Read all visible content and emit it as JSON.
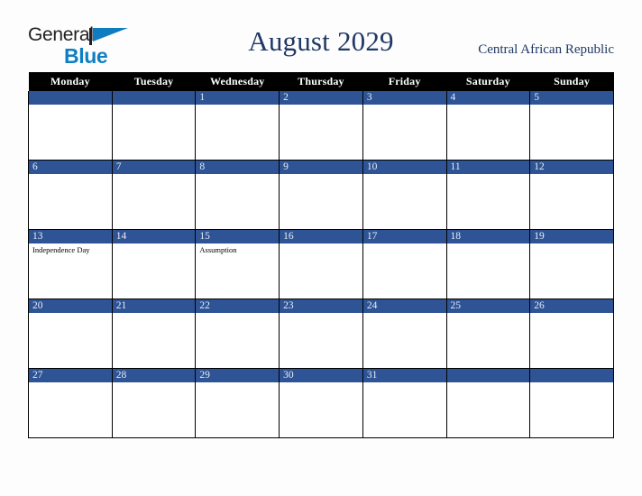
{
  "brand": {
    "name_part1": "General",
    "name_part2": "Blue",
    "accent_color": "#0d7fc4",
    "flag_icon": "flag-triangle-icon"
  },
  "header": {
    "title": "August 2029",
    "country": "Central African Republic",
    "title_color": "#1f3864"
  },
  "calendar": {
    "month": "August",
    "year": "2029",
    "header_bg": "#000000",
    "daynum_bg": "#2e5496",
    "weekdays": [
      "Monday",
      "Tuesday",
      "Wednesday",
      "Thursday",
      "Friday",
      "Saturday",
      "Sunday"
    ],
    "weeks": [
      [
        {
          "day": "",
          "events": []
        },
        {
          "day": "",
          "events": []
        },
        {
          "day": "1",
          "events": []
        },
        {
          "day": "2",
          "events": []
        },
        {
          "day": "3",
          "events": []
        },
        {
          "day": "4",
          "events": []
        },
        {
          "day": "5",
          "events": []
        }
      ],
      [
        {
          "day": "6",
          "events": []
        },
        {
          "day": "7",
          "events": []
        },
        {
          "day": "8",
          "events": []
        },
        {
          "day": "9",
          "events": []
        },
        {
          "day": "10",
          "events": []
        },
        {
          "day": "11",
          "events": []
        },
        {
          "day": "12",
          "events": []
        }
      ],
      [
        {
          "day": "13",
          "events": [
            "Independence Day"
          ]
        },
        {
          "day": "14",
          "events": []
        },
        {
          "day": "15",
          "events": [
            "Assumption"
          ]
        },
        {
          "day": "16",
          "events": []
        },
        {
          "day": "17",
          "events": []
        },
        {
          "day": "18",
          "events": []
        },
        {
          "day": "19",
          "events": []
        }
      ],
      [
        {
          "day": "20",
          "events": []
        },
        {
          "day": "21",
          "events": []
        },
        {
          "day": "22",
          "events": []
        },
        {
          "day": "23",
          "events": []
        },
        {
          "day": "24",
          "events": []
        },
        {
          "day": "25",
          "events": []
        },
        {
          "day": "26",
          "events": []
        }
      ],
      [
        {
          "day": "27",
          "events": []
        },
        {
          "day": "28",
          "events": []
        },
        {
          "day": "29",
          "events": []
        },
        {
          "day": "30",
          "events": []
        },
        {
          "day": "31",
          "events": []
        },
        {
          "day": "",
          "events": []
        },
        {
          "day": "",
          "events": []
        }
      ]
    ]
  }
}
